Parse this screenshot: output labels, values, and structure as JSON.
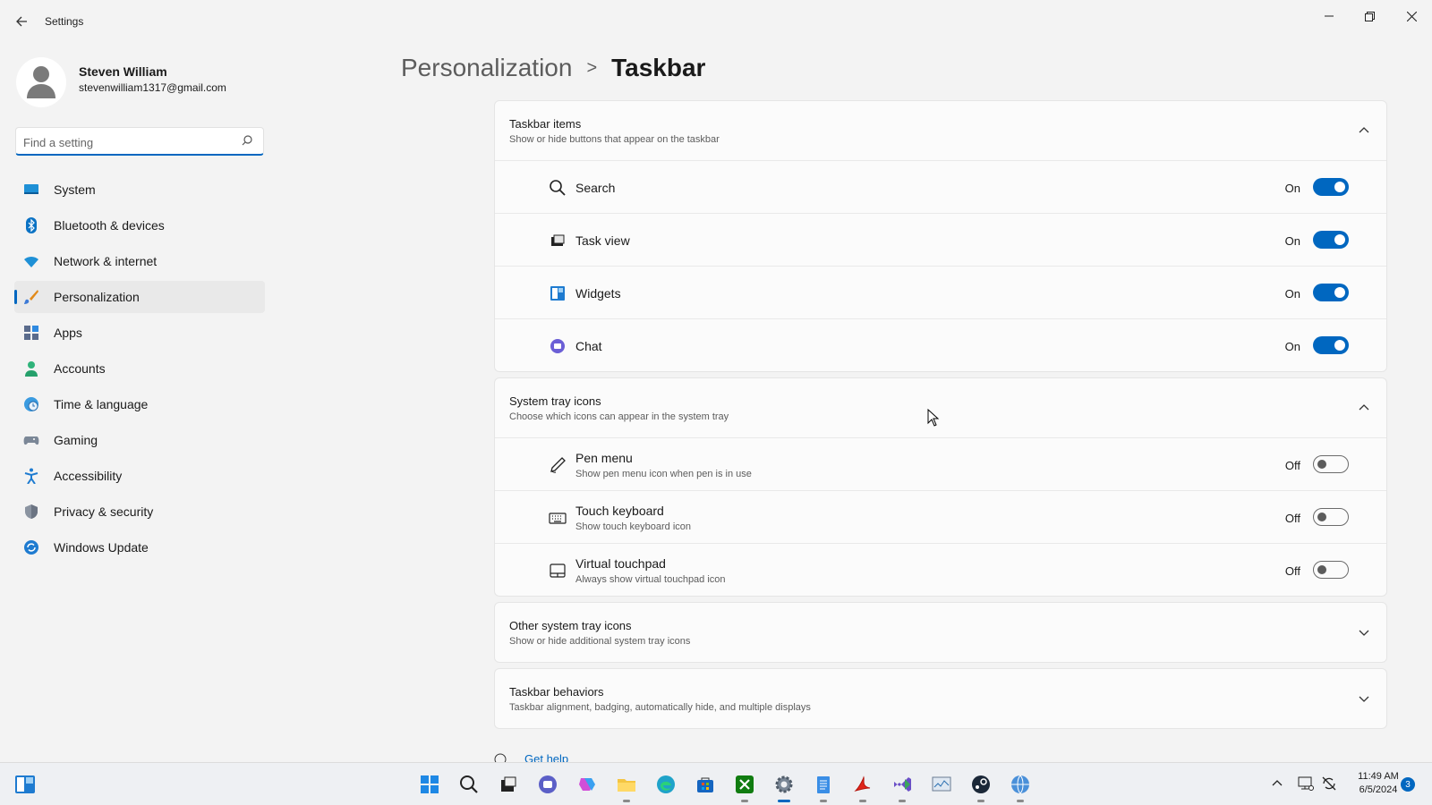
{
  "window": {
    "title": "Settings",
    "back_icon": "back-arrow-icon",
    "controls": [
      "minimize-icon",
      "maximize-icon",
      "close-icon"
    ]
  },
  "profile": {
    "name": "Steven William",
    "email": "stevenwilliam1317@gmail.com"
  },
  "search": {
    "placeholder": "Find a setting",
    "value": ""
  },
  "sidebar": {
    "items": [
      {
        "label": "System",
        "icon": "monitor-icon",
        "active": false
      },
      {
        "label": "Bluetooth & devices",
        "icon": "bluetooth-icon",
        "active": false
      },
      {
        "label": "Network & internet",
        "icon": "wifi-icon",
        "active": false
      },
      {
        "label": "Personalization",
        "icon": "brush-icon",
        "active": true
      },
      {
        "label": "Apps",
        "icon": "apps-icon",
        "active": false
      },
      {
        "label": "Accounts",
        "icon": "person-icon",
        "active": false
      },
      {
        "label": "Time & language",
        "icon": "globe-clock-icon",
        "active": false
      },
      {
        "label": "Gaming",
        "icon": "gamepad-icon",
        "active": false
      },
      {
        "label": "Accessibility",
        "icon": "accessibility-icon",
        "active": false
      },
      {
        "label": "Privacy & security",
        "icon": "shield-icon",
        "active": false
      },
      {
        "label": "Windows Update",
        "icon": "update-icon",
        "active": false
      }
    ]
  },
  "breadcrumb": {
    "parent": "Personalization",
    "separator": ">",
    "current": "Taskbar"
  },
  "sections": {
    "taskbar_items": {
      "title": "Taskbar items",
      "subtitle": "Show or hide buttons that appear on the taskbar",
      "expanded": true,
      "rows": [
        {
          "label": "Search",
          "state": "On",
          "on": true,
          "icon": "search-icon"
        },
        {
          "label": "Task view",
          "state": "On",
          "on": true,
          "icon": "task-view-icon"
        },
        {
          "label": "Widgets",
          "state": "On",
          "on": true,
          "icon": "widgets-icon"
        },
        {
          "label": "Chat",
          "state": "On",
          "on": true,
          "icon": "chat-icon"
        }
      ]
    },
    "system_tray": {
      "title": "System tray icons",
      "subtitle": "Choose which icons can appear in the system tray",
      "expanded": true,
      "rows": [
        {
          "label": "Pen menu",
          "sub": "Show pen menu icon when pen is in use",
          "state": "Off",
          "on": false,
          "icon": "pen-icon"
        },
        {
          "label": "Touch keyboard",
          "sub": "Show touch keyboard icon",
          "state": "Off",
          "on": false,
          "icon": "keyboard-icon"
        },
        {
          "label": "Virtual touchpad",
          "sub": "Always show virtual touchpad icon",
          "state": "Off",
          "on": false,
          "icon": "touchpad-icon"
        }
      ]
    },
    "other_tray": {
      "title": "Other system tray icons",
      "subtitle": "Show or hide additional system tray icons",
      "expanded": false
    },
    "behaviors": {
      "title": "Taskbar behaviors",
      "subtitle": "Taskbar alignment, badging, automatically hide, and multiple displays",
      "expanded": false
    }
  },
  "get_help": "Get help",
  "taskbar": {
    "apps": [
      "start-icon",
      "search-icon",
      "task-view-icon",
      "teams-chat-icon",
      "copilot-icon",
      "file-explorer-icon",
      "edge-icon",
      "store-icon",
      "xbox-icon",
      "settings-icon",
      "notepad-icon",
      "acrobat-icon",
      "visual-studio-icon",
      "performance-monitor-icon",
      "steam-icon",
      "network-globe-icon"
    ],
    "active_app": "settings-icon",
    "time": "11:49 AM",
    "date": "6/5/2024",
    "notification_count": "3"
  },
  "colors": {
    "accent": "#0067c0",
    "background": "#f3f3f3",
    "card": "#fbfbfb"
  }
}
